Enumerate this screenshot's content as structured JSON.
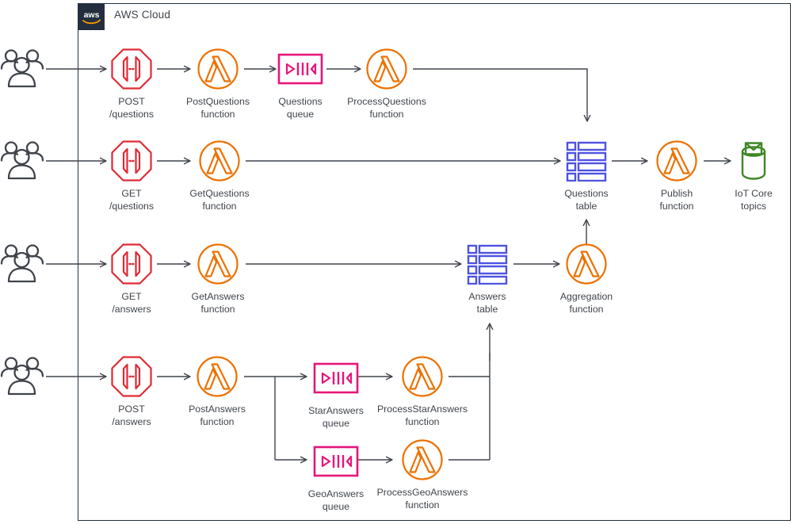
{
  "diagram": {
    "title": "AWS Cloud",
    "boundary_label": "AWS Cloud",
    "logo_text": "aws",
    "type": "aws-architecture-diagram",
    "colors": {
      "aws_navy": "#232f3e",
      "api_gateway_red": "#e7157b_not_used",
      "api_gateway": "#e02a35",
      "lambda_orange": "#ed7100",
      "sqs_pink": "#e7157b",
      "dynamodb_blue": "#4d53e0",
      "iot_green": "#3f8624",
      "line_gray": "#3f444b",
      "text_gray": "#3f444b"
    }
  },
  "rows": [
    {
      "id": "post-questions-row",
      "actor": "users",
      "nodes": [
        {
          "id": "post-questions-api",
          "icon": "api-gateway-icon",
          "label": "POST\n/questions"
        },
        {
          "id": "postquestions-lambda",
          "icon": "lambda-icon",
          "label": "PostQuestions\nfunction"
        },
        {
          "id": "questions-queue",
          "icon": "sqs-queue-icon",
          "label": "Questions\nqueue"
        },
        {
          "id": "processquestions-lambda",
          "icon": "lambda-icon",
          "label": "ProcessQuestions\nfunction"
        }
      ]
    },
    {
      "id": "get-questions-row",
      "actor": "users",
      "nodes": [
        {
          "id": "get-questions-api",
          "icon": "api-gateway-icon",
          "label": "GET\n/questions"
        },
        {
          "id": "getquestions-lambda",
          "icon": "lambda-icon",
          "label": "GetQuestions\nfunction"
        },
        {
          "id": "questions-table",
          "icon": "dynamodb-table-icon",
          "label": "Questions\ntable"
        },
        {
          "id": "publish-lambda",
          "icon": "lambda-icon",
          "label": "Publish\nfunction"
        },
        {
          "id": "iot-core-topics",
          "icon": "iot-core-icon",
          "label": "IoT Core\ntopics"
        }
      ]
    },
    {
      "id": "get-answers-row",
      "actor": "users",
      "nodes": [
        {
          "id": "get-answers-api",
          "icon": "api-gateway-icon",
          "label": "GET\n/answers"
        },
        {
          "id": "getanswers-lambda",
          "icon": "lambda-icon",
          "label": "GetAnswers\nfunction"
        },
        {
          "id": "answers-table",
          "icon": "dynamodb-table-icon",
          "label": "Answers\ntable"
        },
        {
          "id": "aggregation-lambda",
          "icon": "lambda-icon",
          "label": "Aggregation\nfunction"
        }
      ]
    },
    {
      "id": "post-answers-row",
      "actor": "users",
      "nodes": [
        {
          "id": "post-answers-api",
          "icon": "api-gateway-icon",
          "label": "POST\n/answers"
        },
        {
          "id": "postanswers-lambda",
          "icon": "lambda-icon",
          "label": "PostAnswers\nfunction"
        },
        {
          "id": "staranswers-queue",
          "icon": "sqs-queue-icon",
          "label": "StarAnswers\nqueue"
        },
        {
          "id": "processstaranswers-lambda",
          "icon": "lambda-icon",
          "label": "ProcessStarAnswers\nfunction"
        },
        {
          "id": "geoanswers-queue",
          "icon": "sqs-queue-icon",
          "label": "GeoAnswers\nqueue"
        },
        {
          "id": "processgeoanswers-lambda",
          "icon": "lambda-icon",
          "label": "ProcessGeoAnswers\nfunction"
        }
      ]
    }
  ],
  "labels": {
    "post_questions_api": "POST\n/questions",
    "postquestions_function": "PostQuestions\nfunction",
    "questions_queue": "Questions\nqueue",
    "processquestions_function": "ProcessQuestions\nfunction",
    "get_questions_api": "GET\n/questions",
    "getquestions_function": "GetQuestions\nfunction",
    "questions_table": "Questions\ntable",
    "publish_function": "Publish\nfunction",
    "iot_core_topics": "IoT Core\ntopics",
    "get_answers_api": "GET\n/answers",
    "getanswers_function": "GetAnswers\nfunction",
    "answers_table": "Answers\ntable",
    "aggregation_function": "Aggregation\nfunction",
    "post_answers_api": "POST\n/answers",
    "postanswers_function": "PostAnswers\nfunction",
    "staranswers_queue": "StarAnswers\nqueue",
    "processstaranswers_function": "ProcessStarAnswers\nfunction",
    "geoanswers_queue": "GeoAnswers\nqueue",
    "processgeoanswers_function": "ProcessGeoAnswers\nfunction"
  }
}
